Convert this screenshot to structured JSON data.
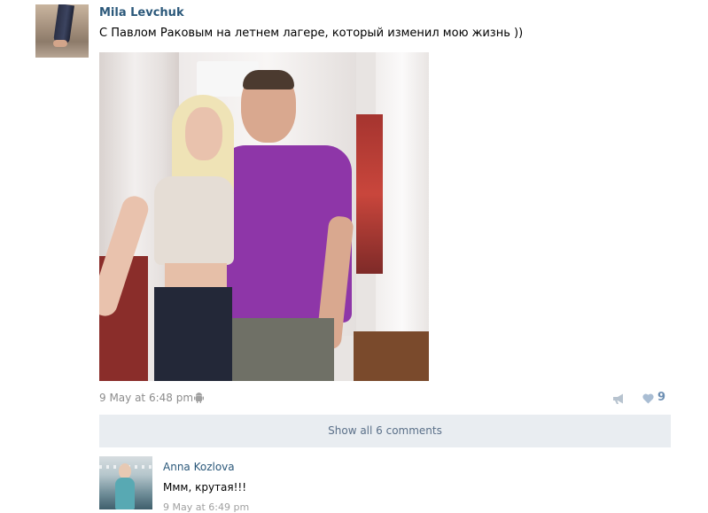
{
  "post": {
    "author": "Mila Levchuk",
    "text": "С Павлом Раковым на летнем лагере, который изменил мою жизнь ))",
    "timestamp": "9 May at 6:48 pm",
    "platform_icon": "android-icon",
    "likes": "9",
    "photo_icon": "photo"
  },
  "comments": {
    "show_all_label": "Show all 6 comments",
    "items": [
      {
        "author": "Anna Kozlova",
        "text": "Ммм, крутая!!!",
        "date": "9 May at 6:49 pm"
      }
    ]
  },
  "colors": {
    "link": "#2b587a",
    "meta": "#8c8c8c",
    "like": "#6d8fb3",
    "show_bg": "#e9edf1"
  }
}
